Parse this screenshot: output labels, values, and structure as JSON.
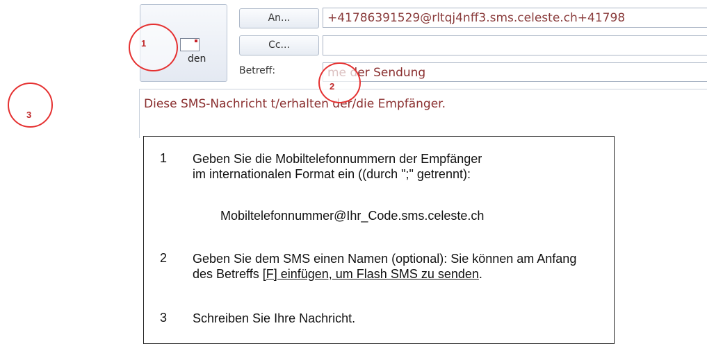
{
  "compose": {
    "send_label": "den",
    "to_button": "An...",
    "cc_button": "Cc...",
    "subject_label": "Betreff:",
    "to_value": "+41786391529@rltqj4nff3.sms.celeste.ch+41798",
    "cc_value": "",
    "subject_value": "me der Sendung",
    "body_text": "Diese SMS-Nachricht         t/erhalten der/die Empfänger."
  },
  "markers": [
    "1",
    "2",
    "3"
  ],
  "legend": {
    "item1": {
      "num": "1",
      "line1": "Geben Sie die Mobiltelefonnummern der Empfänger",
      "line2": "im internationalen Format ein ((durch \";\" getrennt):"
    },
    "example": "Mobiltelefonnummer@Ihr_Code.sms.celeste.ch",
    "item2": {
      "num": "2",
      "text_plain": "Geben Sie dem SMS einen Namen (optional): Sie können am Anfang des Betreffs ",
      "text_underlined": "[F] einfügen, um Flash SMS zu senden",
      "text_end": "."
    },
    "item3": {
      "num": "3",
      "text": "Schreiben Sie Ihre Nachricht."
    }
  },
  "colors": {
    "marker": "#e53030",
    "field_text": "#8a2f2f"
  }
}
